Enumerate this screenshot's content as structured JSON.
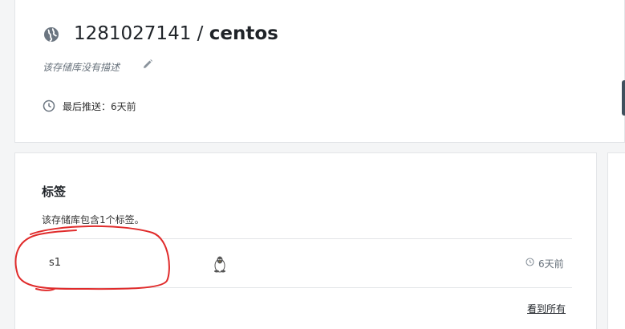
{
  "repo": {
    "owner": "1281027141",
    "separator": " / ",
    "name": "centos",
    "description": "该存储库没有描述",
    "last_push": "最后推送：6天前"
  },
  "tags": {
    "title": "标签",
    "summary": "该存储库包含1个标签。",
    "rows": [
      {
        "name": "s1",
        "os": "linux-icon",
        "time": "6天前"
      }
    ],
    "view_all": "看到所有"
  },
  "colors": {
    "annotation": "#e02b2b",
    "sidebar_button": "#40505d"
  },
  "icons": [
    "globe-icon",
    "pencil-icon",
    "clock-icon",
    "linux-icon"
  ]
}
